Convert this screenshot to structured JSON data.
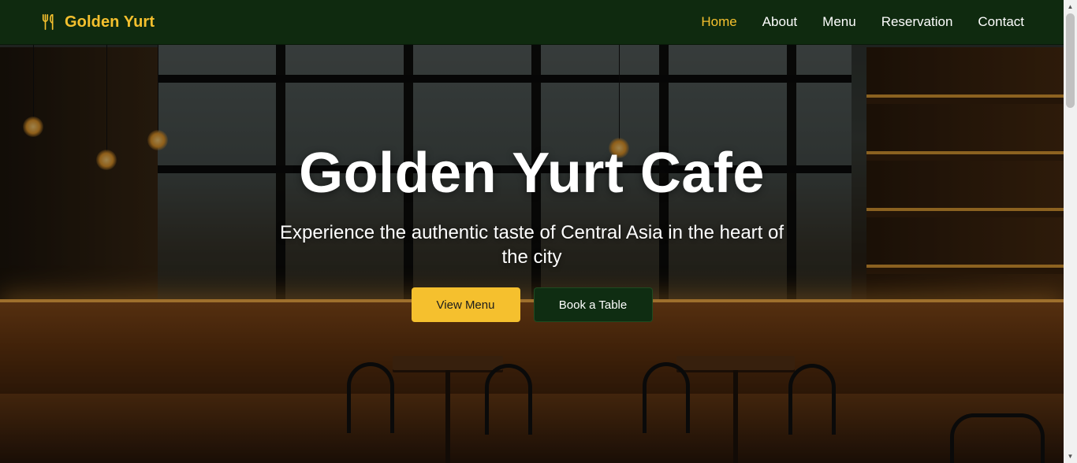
{
  "brand": {
    "name": "Golden Yurt",
    "icon": "utensils-icon",
    "color": "#f5c02e"
  },
  "nav": {
    "items": [
      {
        "label": "Home",
        "active": true
      },
      {
        "label": "About",
        "active": false
      },
      {
        "label": "Menu",
        "active": false
      },
      {
        "label": "Reservation",
        "active": false
      },
      {
        "label": "Contact",
        "active": false
      }
    ]
  },
  "hero": {
    "title": "Golden Yurt Cafe",
    "subtitle": "Experience the authentic taste of Central Asia in the heart of the city",
    "primary_button": "View Menu",
    "secondary_button": "Book a Table"
  },
  "colors": {
    "accent": "#f5c02e",
    "nav_background": "#0e2b0e",
    "secondary_button": "#0f2d12"
  }
}
